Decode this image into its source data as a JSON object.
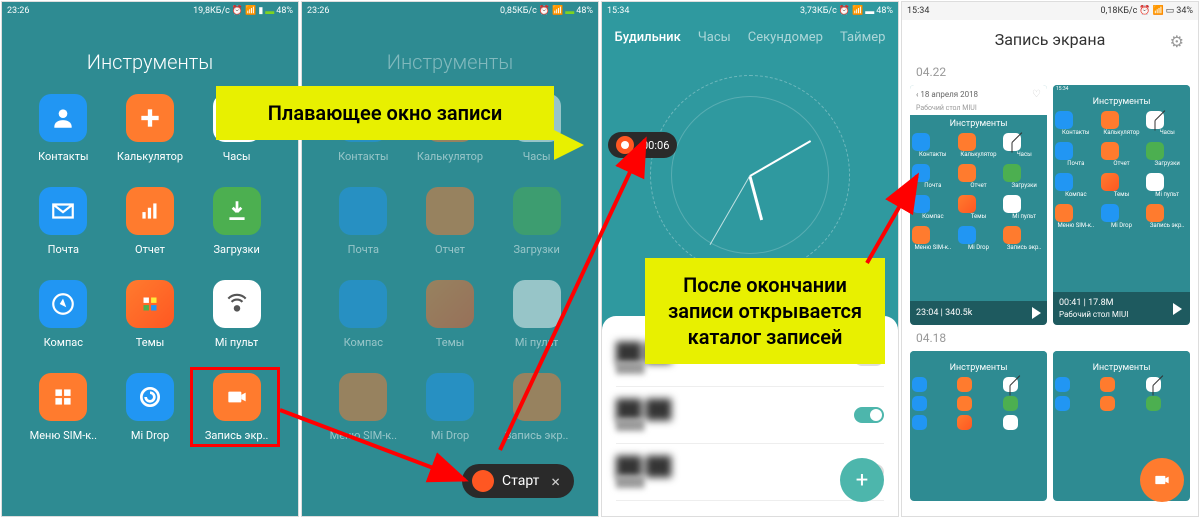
{
  "status": {
    "time_left": "23:26",
    "speed1": "19,8КБ/с",
    "speed2": "0,85КБ/с",
    "speed3": "3,73КБ/с",
    "speed4": "0,18КБ/с",
    "batt_green": "48%",
    "batt_s3": "48%",
    "batt_s4": "34%",
    "time_s3": "15:34",
    "time_s4": "15:34"
  },
  "folder": {
    "title": "Инструменты"
  },
  "apps": {
    "r1": [
      {
        "id": "contacts",
        "label": "Контакты"
      },
      {
        "id": "calc",
        "label": "Калькулятор"
      },
      {
        "id": "clock",
        "label": "Часы"
      }
    ],
    "r2": [
      {
        "id": "mail",
        "label": "Почта"
      },
      {
        "id": "report",
        "label": "Отчет"
      },
      {
        "id": "download",
        "label": "Загрузки"
      }
    ],
    "r3": [
      {
        "id": "compass",
        "label": "Компас"
      },
      {
        "id": "theme",
        "label": "Темы"
      },
      {
        "id": "remote",
        "label": "Mi пульт"
      }
    ],
    "r4": [
      {
        "id": "sim",
        "label": "Меню SIM-к.."
      },
      {
        "id": "midrop",
        "label": "Mi Drop"
      },
      {
        "id": "record",
        "label": "Запись экр.."
      }
    ]
  },
  "callouts": {
    "floating": "Плавающее окно записи",
    "after": "После окончании записи открывается каталог записей"
  },
  "floatbar": {
    "start_label": "Старт",
    "rec_time": "00:06"
  },
  "clock": {
    "tabs": [
      "Будильник",
      "Часы",
      "Секундомер",
      "Таймер"
    ]
  },
  "s4": {
    "header": "Запись экрана",
    "date1": "04.22",
    "date2": "04.18",
    "thumb_date": "18 апреля 2018",
    "thumb_sub": "Рабочий стол MIUI",
    "t1_dur": "23:04",
    "t1_size": "340.5k",
    "t2_dur": "00:41",
    "t2_size": "17.8M",
    "t2_sub": "Рабочий стол MIUI"
  }
}
